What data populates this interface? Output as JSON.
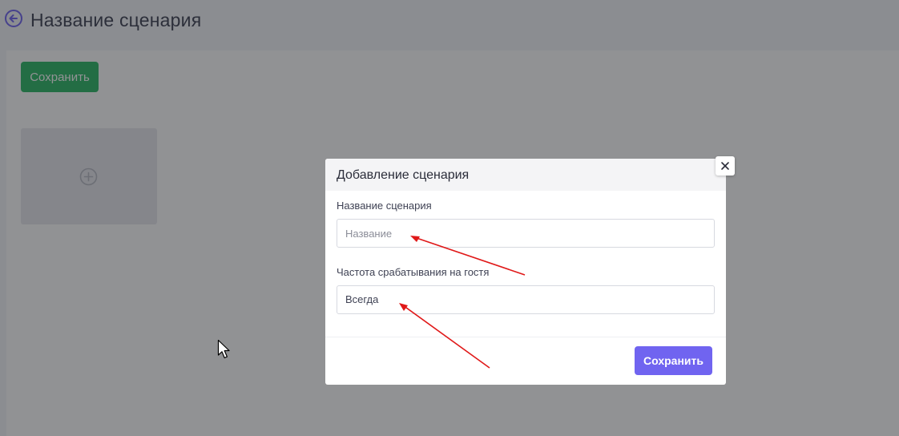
{
  "page": {
    "title": "Название сценария",
    "back_icon": "back-arrow-circle-icon",
    "save_label": "Сохранить",
    "add_card_icon": "plus-circle-icon"
  },
  "modal": {
    "title": "Добавление сценария",
    "close_icon": "close-icon",
    "name_field": {
      "label": "Название сценария",
      "placeholder": "Название",
      "value": ""
    },
    "frequency_field": {
      "label": "Частота срабатывания на гостя",
      "selected": "Всегда"
    },
    "save_label": "Сохранить"
  },
  "annotations": {
    "arrow_color": "#e01818",
    "arrow_targets": [
      "name_field",
      "frequency_field"
    ]
  },
  "colors": {
    "page_save_button": "#2cb866",
    "modal_save_button": "#7064f0",
    "back_icon": "#7064f0"
  }
}
